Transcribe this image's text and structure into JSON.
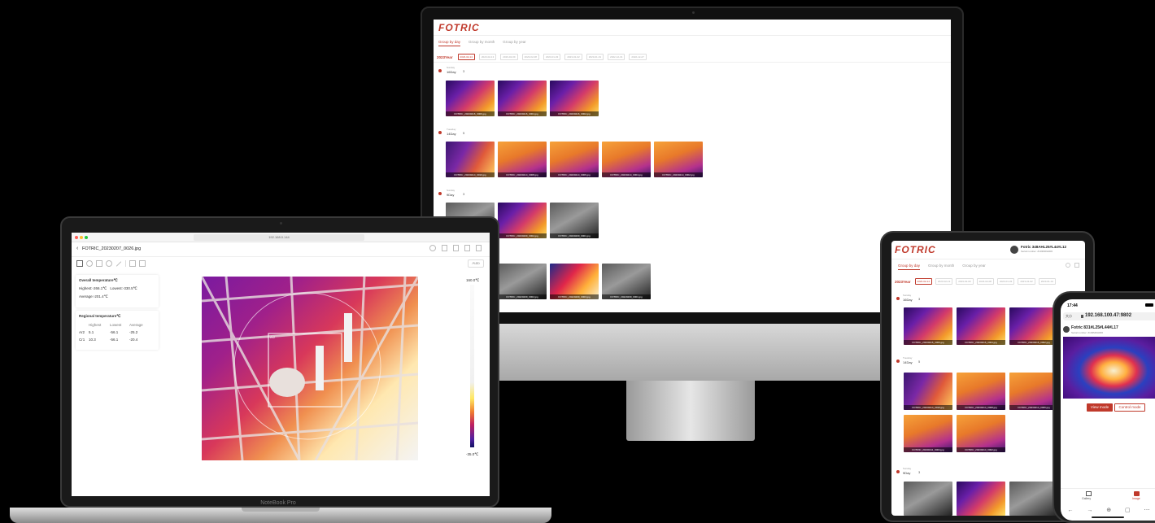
{
  "monitor": {
    "brand": "FOTRIC",
    "tabs": [
      "Group by day",
      "Group by month",
      "Group by year"
    ],
    "year": "2023Year",
    "dates": [
      "2023-02-14",
      "2023-02-13",
      "2023-02-09",
      "2023-02-08",
      "2023-01-03",
      "2023-01-02",
      "2023-01-01",
      "2022-12-31",
      "2022-12-27"
    ],
    "groups": [
      {
        "date": "16Day",
        "weekday": "Sunday",
        "count": "3",
        "thumbs": [
          "FOTRIC_20230216_0006.jpg",
          "FOTRIC_20230216_0004.jpg",
          "FOTRIC_20230216_0002.jpg"
        ]
      },
      {
        "date": "14Day",
        "weekday": "Tuesday",
        "count": "5",
        "thumbs": [
          "FOTRIC_20230214_0010.jpg",
          "FOTRIC_20230214_0008.jpg",
          "FOTRIC_20230214_0006.jpg",
          "FOTRIC_20230214_0004.jpg",
          "FOTRIC_20230214_0002.jpg"
        ]
      },
      {
        "date": "9Day",
        "weekday": "Sunday",
        "count": "3",
        "thumbs": [
          "",
          "FOTRIC_20230209_0002.jpg",
          "FOTRIC_20230209_0001.jpg"
        ]
      },
      {
        "date": "",
        "weekday": "",
        "count": "",
        "thumbs": [
          "FOTRIC_20220209_0002.jpg",
          "FOTRIC_20220209_0003.jpg",
          "FOTRIC_20220209_0001.jpg"
        ]
      }
    ]
  },
  "laptop": {
    "url": "192.168.0.144",
    "title": "FOTRIC_20230207_0026.jpg",
    "auto_label": "Auto",
    "overall_title": "Overall temperature℃",
    "highest": "Highest:-266.1℃",
    "lowest": "Lowest:-330.5℃",
    "average": "Average:-201.4℃",
    "regional_title": "Regional temperature℃",
    "region_headers": [
      "",
      "Highest",
      "Lowest",
      "Average"
    ],
    "region_rows": [
      [
        "Ar2",
        "5.1",
        "-56.1",
        "-25.2"
      ],
      [
        "Cr1",
        "10.3",
        "-56.1",
        "-20.4"
      ]
    ],
    "scale_top": "160.0℃",
    "scale_bottom": "-35.0℃",
    "area_label": "Ar2",
    "brand": "NoteBook Pro"
  },
  "tablet": {
    "brand": "FOTRIC",
    "device_name": "Fotric 348AHL25#L44#L12",
    "serial": "Serial number: Z193MRH006",
    "tabs": [
      "Group by day",
      "Group by month",
      "Group by year"
    ],
    "year": "2023Year",
    "dates": [
      "2023-02-14",
      "2023-02-13",
      "2023-02-09",
      "2023-02-08",
      "2023-01-03",
      "2023-01-02",
      "2023-01-01"
    ],
    "groups": [
      {
        "date": "16Day",
        "weekday": "Sunday",
        "count": "3",
        "thumbs": [
          "FOTRIC_20230216_0006.jpg",
          "FOTRIC_20230216_0004.jpg",
          "FOTRIC_20230216_0002.jpg"
        ]
      },
      {
        "date": "14Day",
        "weekday": "Tuesday",
        "count": "5",
        "thumbs": [
          "FOTRIC_20230214_0010.jpg",
          "FOTRIC_20230214_0008.jpg",
          "FOTRIC_20230214_0006.jpg",
          "FOTRIC_20230211_0004.jpg",
          "FOTRIC_20230214_0002.jpg"
        ]
      },
      {
        "date": "9Day",
        "weekday": "Sunday",
        "count": "3",
        "thumbs": [
          "",
          "",
          ""
        ]
      }
    ]
  },
  "phone": {
    "time": "17:44",
    "url": "192.168.100.47:9802",
    "aa": "大小",
    "device_name": "Fotric 831#L25#L44#L17",
    "serial": "Serial number: Z193MRH006",
    "view_mode": "View mode",
    "control_mode": "Control mode",
    "nav_gallery": "Gallery",
    "nav_image": "Image"
  }
}
